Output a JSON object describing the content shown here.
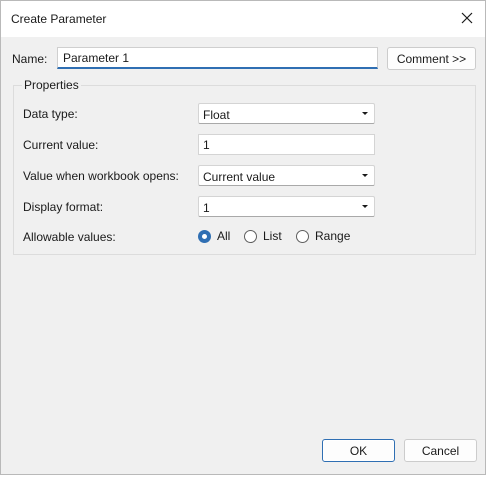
{
  "window": {
    "title": "Create Parameter",
    "close_icon": "close-icon"
  },
  "name_row": {
    "label": "Name:",
    "value": "Parameter 1",
    "comment_button": "Comment >>"
  },
  "properties": {
    "legend": "Properties",
    "data_type": {
      "label": "Data type:",
      "value": "Float"
    },
    "current_value": {
      "label": "Current value:",
      "value": "1"
    },
    "workbook_opens": {
      "label": "Value when workbook opens:",
      "value": "Current value"
    },
    "display_format": {
      "label": "Display format:",
      "value": "1"
    },
    "allowable_values": {
      "label": "Allowable values:",
      "options": [
        "All",
        "List",
        "Range"
      ],
      "selected": "All"
    }
  },
  "footer": {
    "ok_label": "OK",
    "cancel_label": "Cancel"
  },
  "colors": {
    "accent": "#2f6fb3",
    "dialog_bg": "#f0f0f0",
    "titlebar_bg": "#ffffff"
  }
}
